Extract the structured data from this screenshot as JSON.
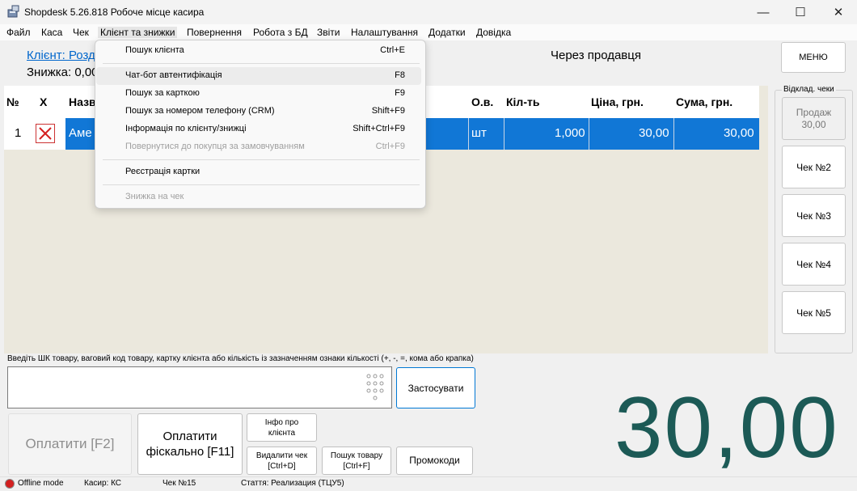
{
  "window": {
    "title": "Shopdesk 5.26.818 Робоче місце касира",
    "minimize_glyph": "—",
    "maximize_glyph": "☐",
    "close_glyph": "✕"
  },
  "menu": {
    "items": [
      "Файл",
      "Каса",
      "Чек",
      "Клієнт та знижки",
      "Повернення",
      "Робота з БД",
      "Звіти",
      "Налаштування",
      "Додатки",
      "Довідка"
    ]
  },
  "client": {
    "link": "Клієнт: Розд",
    "discount": "Знижка: 0,00",
    "seller": "Через продавця",
    "menu_button": "МЕНЮ"
  },
  "table": {
    "headers": {
      "num": "№",
      "x": "Х",
      "name": "Назв",
      "unit": "О.в.",
      "qty": "Кіл-ть",
      "price": "Ціна, грн.",
      "sum": "Сума, грн."
    },
    "row": {
      "num": "1",
      "name": "Аме",
      "unit": "шт",
      "qty": "1,000",
      "price": "30,00",
      "sum": "30,00"
    }
  },
  "deferred": {
    "title": "Відклад. чеки",
    "sale_line1": "Продаж",
    "sale_line2": "30,00",
    "receipts": [
      "Чек №2",
      "Чек №3",
      "Чек №4",
      "Чек №5"
    ]
  },
  "input": {
    "hint": "Введіть ШК товару, ваговий код товару,  картку клієнта або кількість із зазначенням ознаки кількості (+, -, =, кома або крапка)",
    "value": "",
    "apply": "Застосувати"
  },
  "buttons": {
    "pay": "Оплатити [F2]",
    "pay_fiscal_1": "Оплатити",
    "pay_fiscal_2": "фіскально [F11]",
    "client_info_1": "Інфо про",
    "client_info_2": "клієнта",
    "delete_receipt_1": "Видалити чек",
    "delete_receipt_2": "[Ctrl+D]",
    "product_search_1": "Пошук товару",
    "product_search_2": "[Ctrl+F]",
    "promo": "Промокоди"
  },
  "total": "30,00",
  "status": {
    "mode": "Offline mode",
    "cashier": "Касир: КС",
    "receipt": "Чек №15",
    "article": "Стаття: Реализация (ТЦУ5)"
  },
  "dropdown": {
    "items": [
      {
        "label": "Пошук клієнта",
        "shortcut": "Ctrl+E"
      },
      {
        "label": "Чат-бот автентифікація",
        "shortcut": "F8"
      },
      {
        "label": "Пошук за карткою",
        "shortcut": "F9"
      },
      {
        "label": "Пошук за номером телефону (CRM)",
        "shortcut": "Shift+F9"
      },
      {
        "label": "Інформація по клієнту/знижці",
        "shortcut": "Shift+Ctrl+F9"
      },
      {
        "label": "Повернутися до покупця за замовчуванням",
        "shortcut": "Ctrl+F9"
      },
      {
        "label": "Реєстрація картки",
        "shortcut": ""
      },
      {
        "label": "Знижка на чек",
        "shortcut": ""
      }
    ]
  },
  "colors": {
    "accent": "#1177d6",
    "total": "#1c5a56",
    "link": "#0066cc",
    "offline": "#d32020"
  }
}
